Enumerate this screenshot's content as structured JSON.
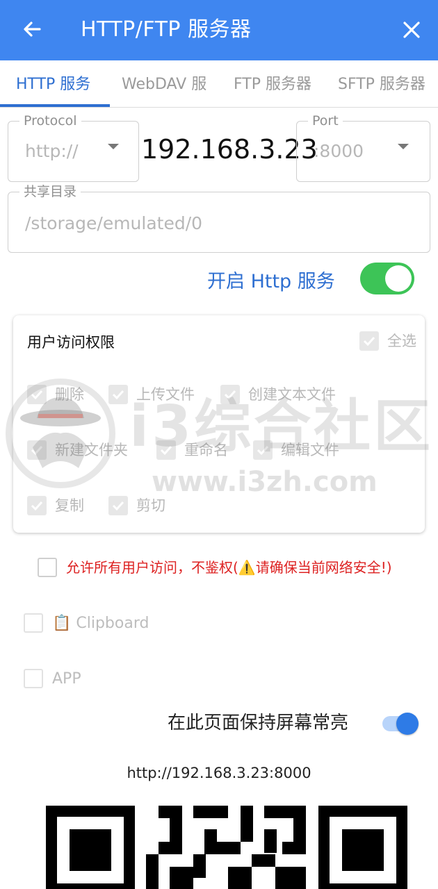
{
  "app_bar": {
    "title": "HTTP/FTP 服务器",
    "back_icon": "arrow-left-icon",
    "close_icon": "close-icon",
    "background": "#3f86f0"
  },
  "tabs": [
    {
      "label": "HTTP 服务",
      "active": true
    },
    {
      "label": "WebDAV 服",
      "active": false
    },
    {
      "label": "FTP 服务器",
      "active": false
    },
    {
      "label": "SFTP 服务器",
      "active": false
    }
  ],
  "protocol": {
    "label": "Protocol",
    "value": "http://"
  },
  "ip_address": "192.168.3.23",
  "port": {
    "label": "Port",
    "value": ":8000"
  },
  "share_dir": {
    "label": "共享目录",
    "placeholder": "/storage/emulated/0"
  },
  "service_switch": {
    "label": "开启 Http 服务",
    "on": true,
    "color": "#3dc457"
  },
  "permissions": {
    "title": "用户访问权限",
    "select_all": "全选",
    "items": [
      {
        "label": "删除",
        "checked": true
      },
      {
        "label": "上传文件",
        "checked": true
      },
      {
        "label": "创建文本文件",
        "checked": true
      },
      {
        "label": "新建文件夹",
        "checked": true
      },
      {
        "label": "重命名",
        "checked": true
      },
      {
        "label": "编辑文件",
        "checked": true
      },
      {
        "label": "复制",
        "checked": true
      },
      {
        "label": "剪切",
        "checked": true
      }
    ]
  },
  "allow_all": {
    "label": "允许所有用户访问，不鉴权(⚠️请确保当前网络安全!)",
    "checked": false,
    "color": "#dd2222"
  },
  "clipboard": {
    "label": "📋 Clipboard",
    "checked": false
  },
  "app_option": {
    "label": "APP",
    "checked": false
  },
  "keep_screen": {
    "label": "在此页面保持屏幕常亮",
    "on": true,
    "color": "#2e7be6"
  },
  "server_url": "http://192.168.3.23:8000",
  "watermark": {
    "text": "i3综合社区",
    "url": "www.i3zh.com"
  }
}
